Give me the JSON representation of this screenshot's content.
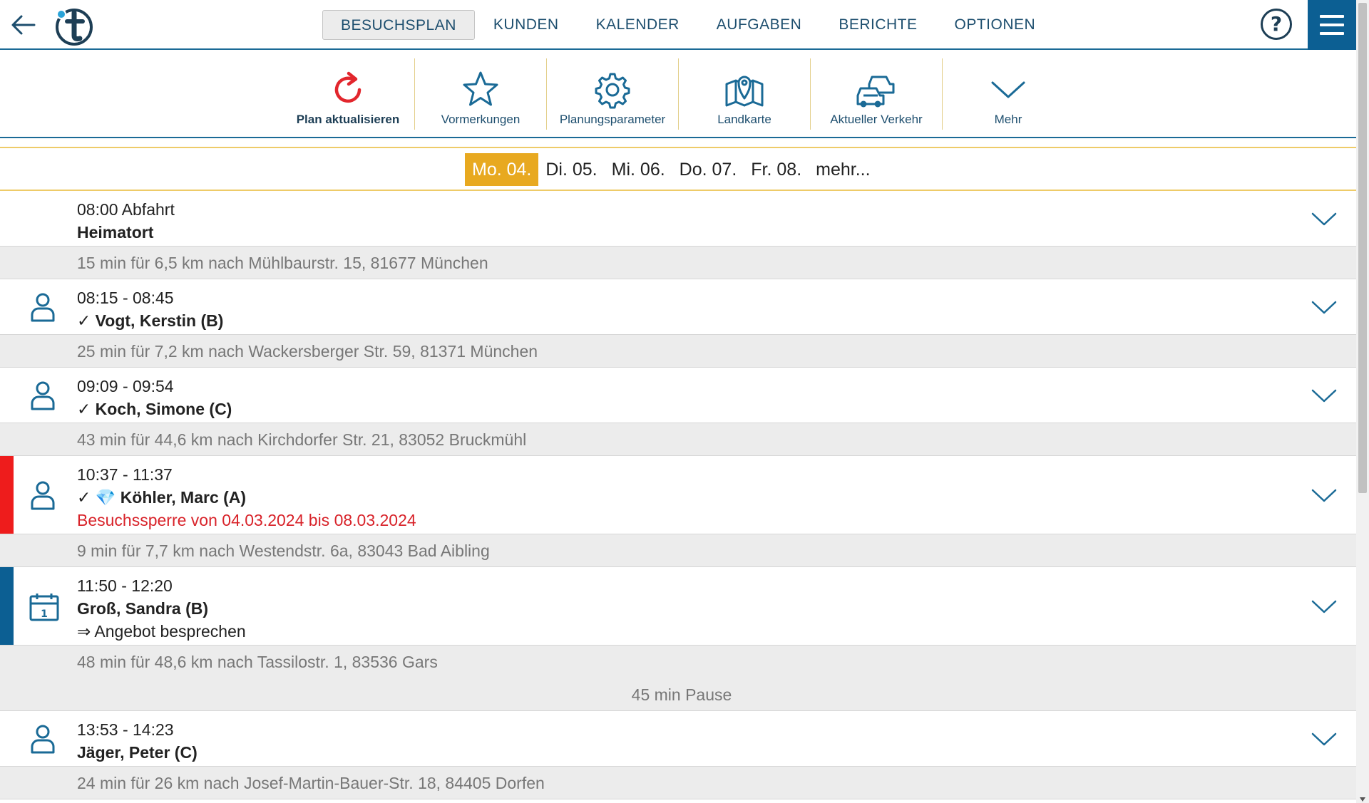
{
  "nav": {
    "items": [
      {
        "label": "BESUCHSPLAN",
        "active": true
      },
      {
        "label": "KUNDEN"
      },
      {
        "label": "KALENDER"
      },
      {
        "label": "AUFGABEN"
      },
      {
        "label": "BERICHTE"
      },
      {
        "label": "OPTIONEN"
      }
    ],
    "help_label": "?",
    "icons": {
      "back": "arrow-left-icon",
      "logo": "t-logo",
      "menu": "hamburger-icon"
    }
  },
  "toolbar": {
    "items": [
      {
        "label": "Plan aktualisieren",
        "icon": "refresh-icon",
        "color": "#e2262d"
      },
      {
        "label": "Vormerkungen",
        "icon": "star-icon"
      },
      {
        "label": "Planungsparameter",
        "icon": "gear-icon"
      },
      {
        "label": "Landkarte",
        "icon": "map-icon"
      },
      {
        "label": "Aktueller Verkehr",
        "icon": "traffic-cars-icon"
      },
      {
        "label": "Mehr",
        "icon": "chevron-down-icon"
      }
    ]
  },
  "days": {
    "items": [
      "Mo. 04.",
      "Di. 05.",
      "Mi. 06.",
      "Do. 07.",
      "Fr. 08.",
      "mehr..."
    ],
    "active_index": 0,
    "active_color": "#e8a920"
  },
  "schedule": {
    "entries": [
      {
        "time": "08:00 Abfahrt",
        "name": "Heimatort",
        "route": "15 min für 6,5 km nach Mühlbaurstr. 15, 81677 München"
      },
      {
        "time": "08:15 - 08:45",
        "name": "✓ Vogt, Kerstin (B)",
        "icon": "person-icon",
        "route": "25 min für 7,2 km nach Wackersberger Str. 59, 81371 München"
      },
      {
        "time": "09:09 - 09:54",
        "name": "✓ Koch, Simone (C)",
        "icon": "person-icon",
        "route": "43 min für 44,6 km nach Kirchdorfer Str. 21, 83052 Bruckmühl"
      },
      {
        "time": "10:37 - 11:37",
        "name": "✓ 💎 Köhler, Marc (A)",
        "warning": "Besuchssperre von 04.03.2024 bis 08.03.2024",
        "icon": "person-icon",
        "stripe_color": "#ee1c1c",
        "route": "9 min für 7,7 km nach Westendstr. 6a, 83043 Bad Aibling"
      },
      {
        "time": "11:50 - 12:20",
        "name": "Groß, Sandra (B)",
        "note": "⇒ Angebot besprechen",
        "icon": "calendar-icon",
        "stripe_color": "#0c5f93",
        "route": "48 min für 48,6 km nach Tassilostr. 1, 83536 Gars",
        "pause": "45 min Pause"
      },
      {
        "time": "13:53 - 14:23",
        "name": "Jäger, Peter (C)",
        "icon": "person-icon",
        "route": "24 min für 26 km nach Josef-Martin-Bauer-Str. 18, 84405 Dorfen"
      }
    ]
  },
  "colors": {
    "brand": "#0c5f93",
    "text_dark": "#1d4e6e",
    "warning": "#d8232a"
  }
}
